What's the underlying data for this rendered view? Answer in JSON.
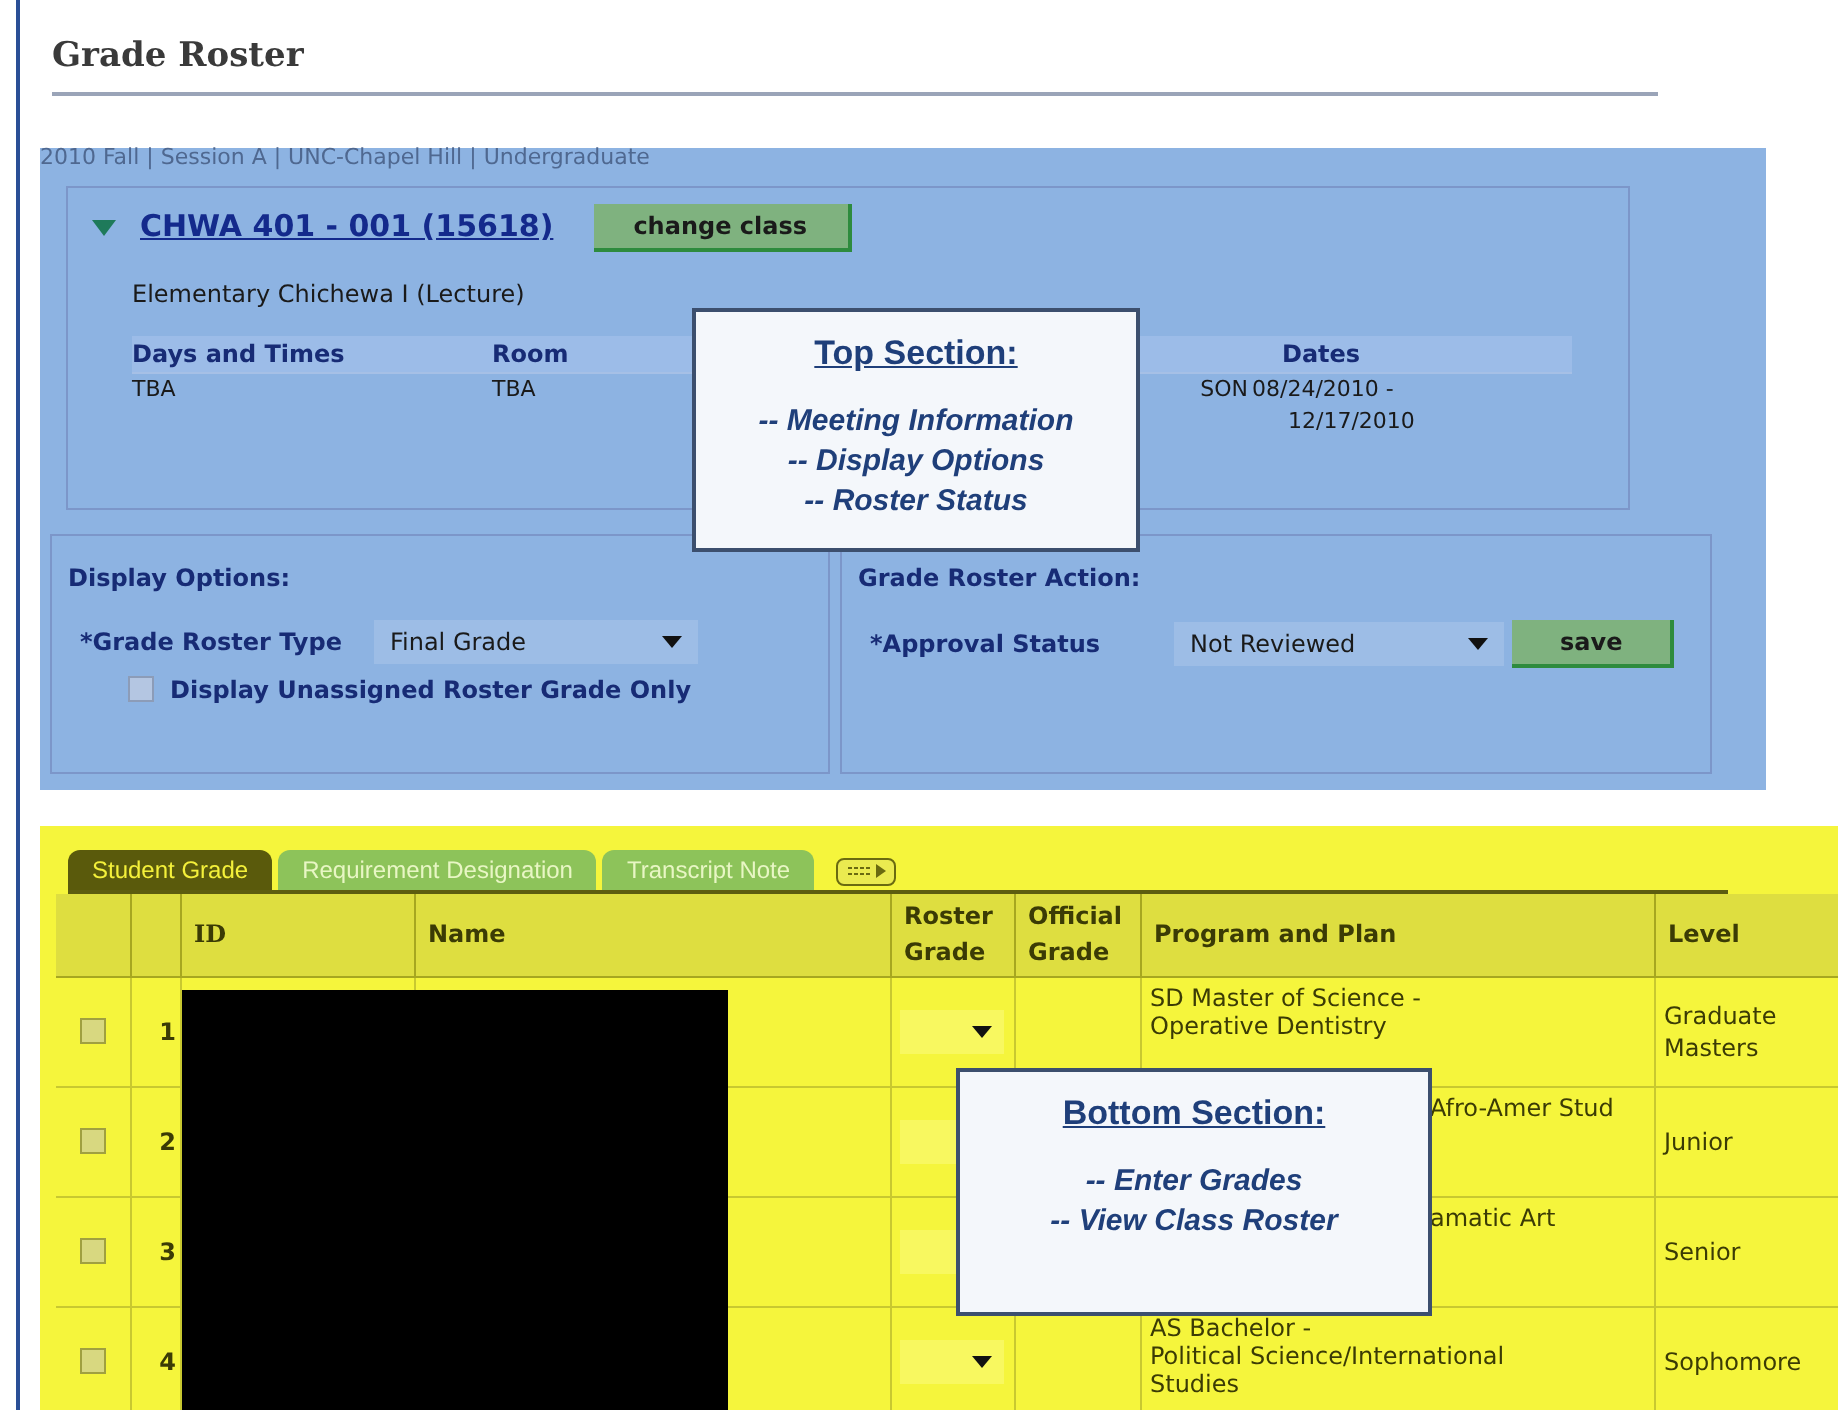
{
  "title": "Grade Roster",
  "term": "2010 Fall | Session A | UNC-Chapel Hill | Undergraduate",
  "class": {
    "expanded": true,
    "code": "CHWA 401 - 001 (15618)",
    "change_button": "change class",
    "description": "Elementary Chichewa I (Lecture)"
  },
  "meeting": {
    "columns": [
      "Days and Times",
      "Room",
      "Dates"
    ],
    "rows": [
      {
        "days": "TBA",
        "room": "TBA",
        "instructor": "SON",
        "dates": [
          "08/24/2010 -",
          "12/17/2010"
        ]
      }
    ]
  },
  "top_callout": {
    "title": "Top Section:",
    "lines": [
      "-- Meeting Information",
      "-- Display Options",
      "-- Roster Status"
    ]
  },
  "display_options": {
    "heading": "Display Options:",
    "roster_type_label": "*Grade Roster Type",
    "roster_type": "Final Grade",
    "unassigned_only": {
      "label": "Display Unassigned Roster Grade Only",
      "checked": false
    }
  },
  "action": {
    "heading": "Grade Roster Action:",
    "approval_label": "*Approval Status",
    "approval": "Not Reviewed",
    "save": "save"
  },
  "tabs": [
    {
      "label": "Student Grade",
      "selected": true
    },
    {
      "label": "Requirement Designation",
      "selected": false
    },
    {
      "label": "Transcript Note",
      "selected": false
    }
  ],
  "table": {
    "columns": [
      "ID",
      "Name",
      "Roster Grade",
      "Official Grade",
      "Program and Plan",
      "Level"
    ],
    "rows": [
      {
        "number": "1",
        "checked": false,
        "program": [
          {
            "kind": "full",
            "text": "SD Master of Science -"
          },
          {
            "kind": "full",
            "text": "Operative Dentistry"
          }
        ],
        "level": "Graduate Masters"
      },
      {
        "number": "2",
        "checked": false,
        "program": [
          {
            "kind": "partial",
            "text": "Afro-Amer Stud"
          }
        ],
        "level": "Junior"
      },
      {
        "number": "3",
        "checked": false,
        "program": [
          {
            "kind": "partial",
            "text": "amatic Art"
          }
        ],
        "level": "Senior"
      },
      {
        "number": "4",
        "checked": false,
        "program": [
          {
            "kind": "full",
            "text": "AS Bachelor -"
          },
          {
            "kind": "full",
            "text": "Political Science/International"
          },
          {
            "kind": "full",
            "text": "Studies"
          }
        ],
        "level": "Sophomore"
      }
    ]
  },
  "bottom_callout": {
    "title": "Bottom Section:",
    "lines": [
      "-- Enter Grades",
      "-- View Class Roster"
    ]
  }
}
